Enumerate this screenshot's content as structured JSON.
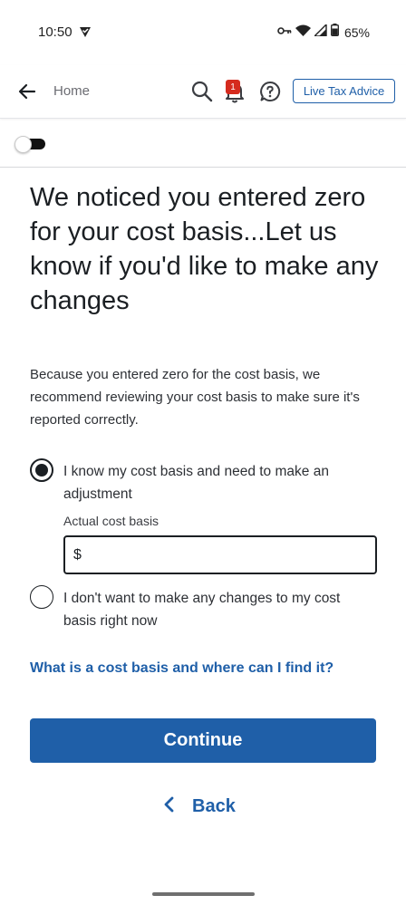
{
  "status_bar": {
    "time": "10:50",
    "battery_percent": "65%"
  },
  "header": {
    "home_label": "Home",
    "notification_count": "1",
    "live_advice_label": "Live Tax Advice"
  },
  "toggle": {
    "state": "on"
  },
  "content": {
    "heading": "We noticed you entered zero for your cost basis...Let us know if you'd like to make any changes",
    "description": "Because you entered zero for the cost basis, we recommend reviewing your cost basis to make sure it's reported correctly.",
    "option_1_label": "I know my cost basis and need to make an adjustment",
    "option_1_selected": true,
    "cost_basis_field_label": "Actual cost basis",
    "currency_symbol": "$",
    "cost_basis_value": "",
    "option_2_label": "I don't want to make any changes to my cost basis right now",
    "option_2_selected": false,
    "help_link": "What is a cost basis and where can I find it?",
    "continue_label": "Continue",
    "back_label": "Back"
  },
  "colors": {
    "accent": "#1f5fa8",
    "badge": "#d52b1e",
    "text": "#1b1f23"
  }
}
